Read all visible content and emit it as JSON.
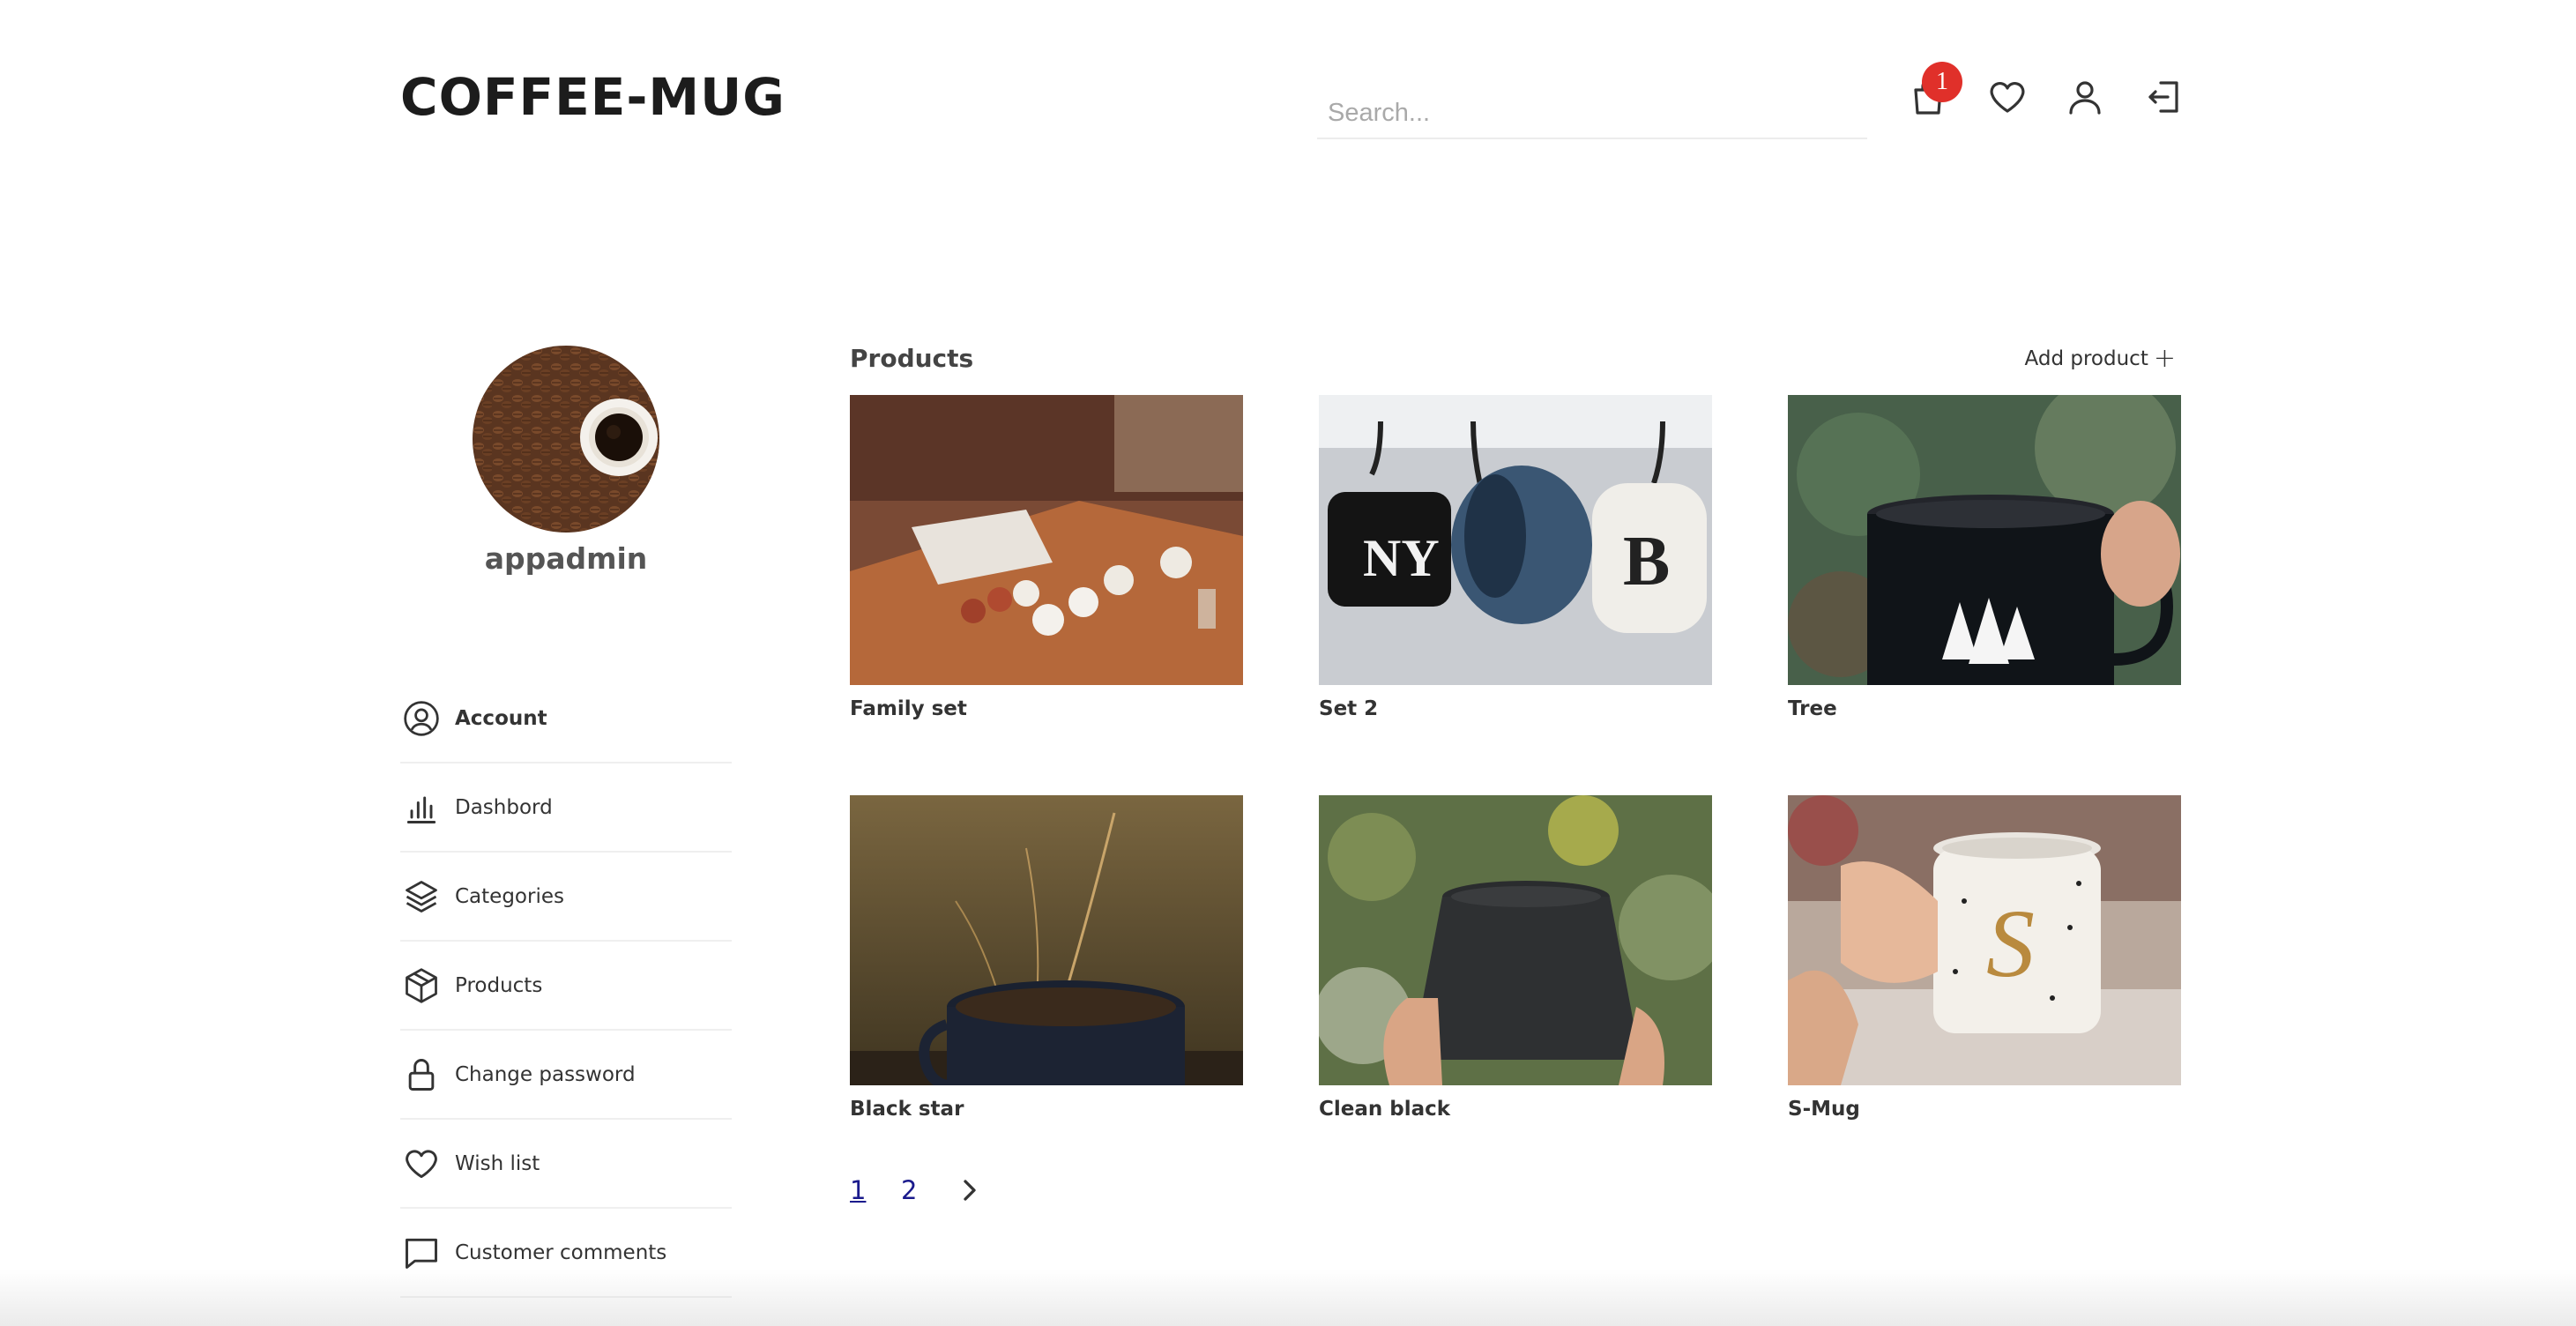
{
  "header": {
    "logo": "COFFEE-MUG",
    "search_placeholder": "Search...",
    "cart_count": "1",
    "icons": [
      "shopping-bag-icon",
      "heart-icon",
      "user-icon",
      "logout-icon"
    ]
  },
  "profile": {
    "username": "appadmin"
  },
  "sidebar": {
    "items": [
      {
        "label": "Account",
        "icon": "user-circle-icon",
        "active": true
      },
      {
        "label": "Dashbord",
        "icon": "bar-chart-icon",
        "active": false
      },
      {
        "label": "Categories",
        "icon": "layers-icon",
        "active": false
      },
      {
        "label": "Products",
        "icon": "package-icon",
        "active": false
      },
      {
        "label": "Change password",
        "icon": "lock-icon",
        "active": false
      },
      {
        "label": "Wish list",
        "icon": "heart-icon",
        "active": false
      },
      {
        "label": "Customer comments",
        "icon": "comment-icon",
        "active": false
      }
    ]
  },
  "products": {
    "title": "Products",
    "add_label": "Add product",
    "items": [
      {
        "name": "Family set"
      },
      {
        "name": "Set 2"
      },
      {
        "name": "Tree"
      },
      {
        "name": "Black star"
      },
      {
        "name": "Clean black"
      },
      {
        "name": "S-Mug"
      }
    ]
  },
  "pagination": {
    "pages": [
      "1",
      "2"
    ],
    "current": "1"
  },
  "colors": {
    "badge": "#e0302a",
    "pager_link": "#1a1a8c"
  }
}
